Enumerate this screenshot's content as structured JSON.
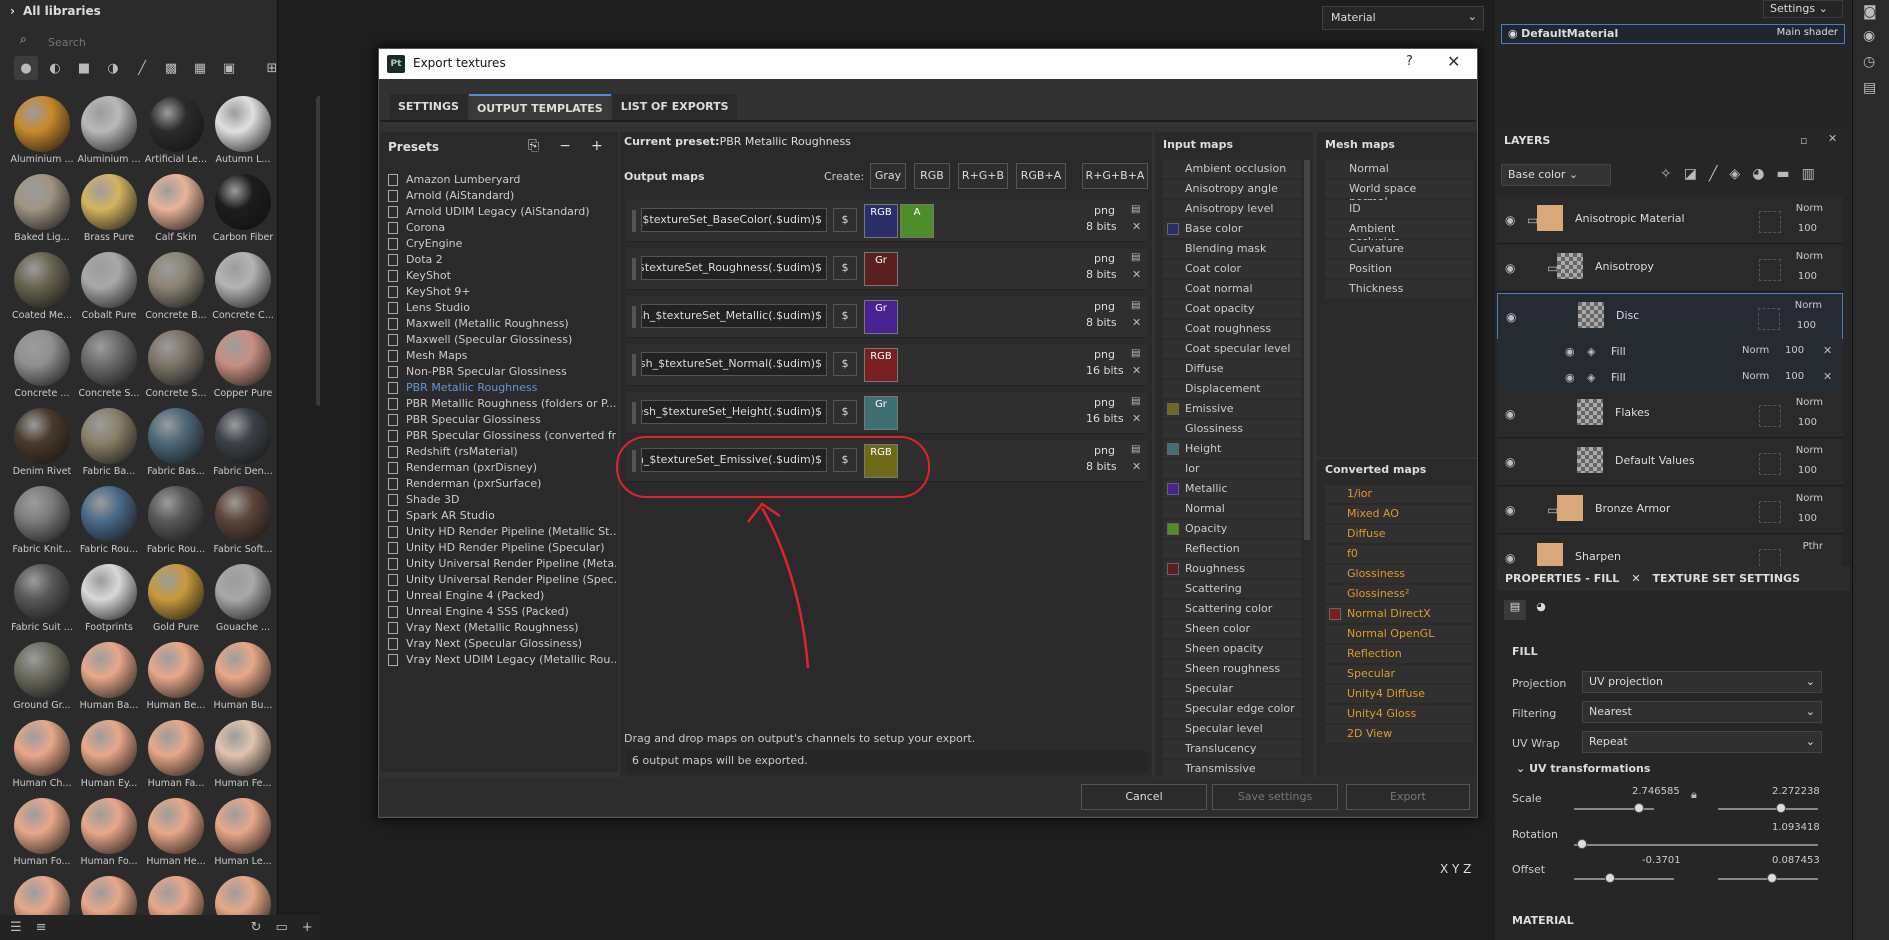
{
  "library": {
    "title": "All libraries",
    "search_placeholder": "Search",
    "materials": [
      {
        "label": "Aluminium ...",
        "color": "#c8892b"
      },
      {
        "label": "Aluminium ...",
        "color": "#b9b9b9"
      },
      {
        "label": "Artificial Le...",
        "color": "#2b2b2b"
      },
      {
        "label": "Autumn L...",
        "color": "#e0e0e0"
      },
      {
        "label": "Baked Lig...",
        "color": "#a09484"
      },
      {
        "label": "Brass Pure",
        "color": "#d4b460"
      },
      {
        "label": "Calf Skin",
        "color": "#e8b49a"
      },
      {
        "label": "Carbon Fiber",
        "color": "#1c1c1c"
      },
      {
        "label": "Coated Me...",
        "color": "#6a6350"
      },
      {
        "label": "Cobalt Pure",
        "color": "#a8a8a8"
      },
      {
        "label": "Concrete B...",
        "color": "#8c8476"
      },
      {
        "label": "Concrete C...",
        "color": "#b4b4b4"
      },
      {
        "label": "Concrete ...",
        "color": "#909090"
      },
      {
        "label": "Concrete S...",
        "color": "#6c6c6c"
      },
      {
        "label": "Concrete S...",
        "color": "#7c7468"
      },
      {
        "label": "Copper Pure",
        "color": "#c89080"
      },
      {
        "label": "Denim Rivet",
        "color": "#4a3a2c"
      },
      {
        "label": "Fabric Ba...",
        "color": "#8a8068"
      },
      {
        "label": "Fabric Bas...",
        "color": "#4c6878"
      },
      {
        "label": "Fabric Den...",
        "color": "#3c4148"
      },
      {
        "label": "Fabric Knit...",
        "color": "#7c7c7c"
      },
      {
        "label": "Fabric Rou...",
        "color": "#4a6a8a"
      },
      {
        "label": "Fabric Rou...",
        "color": "#585858"
      },
      {
        "label": "Fabric Soft...",
        "color": "#5c4438"
      },
      {
        "label": "Fabric Suit ...",
        "color": "#585858"
      },
      {
        "label": "Footprints",
        "color": "#d8d8d8"
      },
      {
        "label": "Gold Pure",
        "color": "#c89a3c"
      },
      {
        "label": "Gouache ...",
        "color": "#a8a8a8"
      },
      {
        "label": "Ground Gr...",
        "color": "#6c6c60"
      },
      {
        "label": "Human Ba...",
        "color": "#e8a88a"
      },
      {
        "label": "Human Be...",
        "color": "#e8a88a"
      },
      {
        "label": "Human Bu...",
        "color": "#e8a88a"
      },
      {
        "label": "Human Ch...",
        "color": "#e8a88a"
      },
      {
        "label": "Human Ey...",
        "color": "#e8a88a"
      },
      {
        "label": "Human Fa...",
        "color": "#e8a88a"
      },
      {
        "label": "Human Fe...",
        "color": "#e0c4b0"
      },
      {
        "label": "Human Fo...",
        "color": "#e8a88a"
      },
      {
        "label": "Human Fo...",
        "color": "#e8a88a"
      },
      {
        "label": "Human He...",
        "color": "#e8a88a"
      },
      {
        "label": "Human Le...",
        "color": "#e8a88a"
      },
      {
        "label": "",
        "color": "#e8a88a"
      },
      {
        "label": "",
        "color": "#e8a88a"
      },
      {
        "label": "",
        "color": "#e8a88a"
      },
      {
        "label": "",
        "color": "#e8a88a"
      }
    ]
  },
  "viewport": {
    "material_select": "Material",
    "axes": "X Y Z"
  },
  "right": {
    "settings_label": "Settings",
    "texture_set": {
      "name": "DefaultMaterial",
      "shader": "Main shader"
    },
    "layers_title": "LAYERS",
    "channel_select": "Base color",
    "layers": [
      {
        "name": "Anisotropic Material",
        "blend": "Norm",
        "opacity": "100",
        "thumb": "#d8a878"
      },
      {
        "name": "Anisotropy",
        "blend": "Norm",
        "opacity": "100",
        "thumb": "checker"
      },
      {
        "name": "Disc",
        "blend": "Norm",
        "opacity": "100",
        "thumb": "checker"
      },
      {
        "name": "Flakes",
        "blend": "Norm",
        "opacity": "100",
        "thumb": "checker"
      },
      {
        "name": "Default Values",
        "blend": "Norm",
        "opacity": "100",
        "thumb": "checker"
      },
      {
        "name": "Bronze Armor",
        "blend": "Norm",
        "opacity": "100",
        "thumb": "#d8a878"
      },
      {
        "name": "Sharpen",
        "blend": "Pthr",
        "opacity": "",
        "thumb": "#d8a878"
      }
    ],
    "fills": [
      {
        "name": "Fill",
        "blend": "Norm",
        "opacity": "100"
      },
      {
        "name": "Fill",
        "blend": "Norm",
        "opacity": "100"
      }
    ],
    "props_tab": "PROPERTIES - FILL",
    "texset_tab": "TEXTURE SET SETTINGS",
    "fill_heading": "FILL",
    "projection_label": "Projection",
    "projection_value": "UV projection",
    "filtering_label": "Filtering",
    "filtering_value": "Nearest",
    "uvwrap_label": "UV Wrap",
    "uvwrap_value": "Repeat",
    "uv_transform": "UV transformations",
    "scale_label": "Scale",
    "scale_a": "2.746585",
    "scale_b": "2.272238",
    "rotation_label": "Rotation",
    "rotation_value": "1.093418",
    "offset_label": "Offset",
    "offset_a": "-0.3701",
    "offset_b": "0.087453",
    "material_heading": "MATERIAL"
  },
  "dialog": {
    "logo": "Pt",
    "title": "Export textures",
    "help": "?",
    "close": "✕",
    "tabs": [
      "SETTINGS",
      "OUTPUT TEMPLATES",
      "LIST OF EXPORTS"
    ],
    "presets_title": "Presets",
    "presets": [
      "Amazon Lumberyard",
      "Arnold (AiStandard)",
      "Arnold UDIM Legacy (AiStandard)",
      "Corona",
      "CryEngine",
      "Dota 2",
      "KeyShot",
      "KeyShot 9+",
      "Lens Studio",
      "Maxwell (Metallic Roughness)",
      "Maxwell (Specular Glossiness)",
      "Mesh Maps",
      "Non-PBR Specular Glossiness",
      "PBR Metallic Roughness",
      "PBR Metallic Roughness (folders or P...",
      "PBR Specular Glossiness",
      "PBR Specular Glossiness (converted fr...",
      "Redshift (rsMaterial)",
      "Renderman (pxrDisney)",
      "Renderman (pxrSurface)",
      "Shade 3D",
      "Spark AR Studio",
      "Unity HD Render Pipeline (Metallic St...",
      "Unity HD Render Pipeline (Specular)",
      "Unity Universal Render Pipeline (Meta...",
      "Unity Universal Render Pipeline (Spec...",
      "Unreal Engine 4 (Packed)",
      "Unreal Engine 4 SSS (Packed)",
      "Vray Next (Metallic Roughness)",
      "Vray Next (Specular Glossiness)",
      "Vray Next UDIM Legacy (Metallic Rou..."
    ],
    "selected_preset_index": 13,
    "current_preset_label": "Current preset:",
    "current_preset": "PBR Metallic Roughness",
    "output_maps_title": "Output maps",
    "create_label": "Create:",
    "create_buttons": [
      "Gray",
      "RGB",
      "R+G+B",
      "RGB+A",
      "R+G+B+A"
    ],
    "outputs": [
      {
        "name": "$mesh_$textureSet_BaseColor(.$udim)",
        "dollar": "$",
        "ch1": "RGB",
        "ch1_color": "#2a2f6a",
        "ch2": "A",
        "ch2_color": "#4f8d2a",
        "format": "png",
        "bits": "8 bits"
      },
      {
        "name": "$mesh_$textureSet_Roughness(.$udim)",
        "dollar": "$",
        "ch1": "Gr",
        "ch1_color": "#5a1f1f",
        "ch2": "",
        "ch2_color": "",
        "format": "png",
        "bits": "8 bits"
      },
      {
        "name": "$mesh_$textureSet_Metallic(.$udim)",
        "dollar": "$",
        "ch1": "Gr",
        "ch1_color": "#4a2190",
        "ch2": "",
        "ch2_color": "",
        "format": "png",
        "bits": "8 bits"
      },
      {
        "name": "$mesh_$textureSet_Normal(.$udim)",
        "dollar": "$",
        "ch1": "RGB",
        "ch1_color": "#7a1f1f",
        "ch2": "",
        "ch2_color": "",
        "format": "png",
        "bits": "16 bits"
      },
      {
        "name": "$mesh_$textureSet_Height(.$udim)",
        "dollar": "$",
        "ch1": "Gr",
        "ch1_color": "#3e6f72",
        "ch2": "",
        "ch2_color": "",
        "format": "png",
        "bits": "16 bits"
      },
      {
        "name": "$mesh_$textureSet_Emissive(.$udim)",
        "dollar": "$",
        "ch1": "RGB",
        "ch1_color": "#6e6a18",
        "ch2": "",
        "ch2_color": "",
        "format": "png",
        "bits": "8 bits"
      }
    ],
    "hint": "Drag and drop maps on output's channels to setup your export.",
    "count": "6 output maps will be exported.",
    "input_title": "Input maps",
    "inputs": [
      {
        "name": "Ambient occlusion",
        "color": ""
      },
      {
        "name": "Anisotropy angle",
        "color": ""
      },
      {
        "name": "Anisotropy level",
        "color": ""
      },
      {
        "name": "Base color",
        "color": "#2a2f6a"
      },
      {
        "name": "Blending mask",
        "color": ""
      },
      {
        "name": "Coat color",
        "color": ""
      },
      {
        "name": "Coat normal",
        "color": ""
      },
      {
        "name": "Coat opacity",
        "color": ""
      },
      {
        "name": "Coat roughness",
        "color": ""
      },
      {
        "name": "Coat specular level",
        "color": ""
      },
      {
        "name": "Diffuse",
        "color": ""
      },
      {
        "name": "Displacement",
        "color": ""
      },
      {
        "name": "Emissive",
        "color": "#6e6a18"
      },
      {
        "name": "Glossiness",
        "color": ""
      },
      {
        "name": "Height",
        "color": "#3e6f72"
      },
      {
        "name": "Ior",
        "color": ""
      },
      {
        "name": "Metallic",
        "color": "#4a2190"
      },
      {
        "name": "Normal",
        "color": ""
      },
      {
        "name": "Opacity",
        "color": "#4f8d2a"
      },
      {
        "name": "Reflection",
        "color": ""
      },
      {
        "name": "Roughness",
        "color": "#5a1f1f"
      },
      {
        "name": "Scattering",
        "color": ""
      },
      {
        "name": "Scattering color",
        "color": ""
      },
      {
        "name": "Sheen color",
        "color": ""
      },
      {
        "name": "Sheen opacity",
        "color": ""
      },
      {
        "name": "Sheen roughness",
        "color": ""
      },
      {
        "name": "Specular",
        "color": ""
      },
      {
        "name": "Specular edge color",
        "color": ""
      },
      {
        "name": "Specular level",
        "color": ""
      },
      {
        "name": "Translucency",
        "color": ""
      },
      {
        "name": "Transmissive",
        "color": ""
      }
    ],
    "mesh_title": "Mesh maps",
    "mesh": [
      "Normal",
      "World space normal",
      "ID",
      "Ambient occlusion",
      "Curvature",
      "Position",
      "Thickness"
    ],
    "converted_title": "Converted maps",
    "converted": [
      {
        "name": "1/ior",
        "color": ""
      },
      {
        "name": "Mixed AO",
        "color": ""
      },
      {
        "name": "Diffuse",
        "color": ""
      },
      {
        "name": "f0",
        "color": ""
      },
      {
        "name": "Glossiness",
        "color": ""
      },
      {
        "name": "Glossiness²",
        "color": ""
      },
      {
        "name": "Normal DirectX",
        "color": "#7a1f1f"
      },
      {
        "name": "Normal OpenGL",
        "color": ""
      },
      {
        "name": "Reflection",
        "color": ""
      },
      {
        "name": "Specular",
        "color": ""
      },
      {
        "name": "Unity4 Diffuse",
        "color": ""
      },
      {
        "name": "Unity4 Gloss",
        "color": ""
      },
      {
        "name": "2D View",
        "color": ""
      }
    ],
    "cancel": "Cancel",
    "save_settings": "Save settings",
    "export": "Export"
  },
  "annotation_color": "#e0232b"
}
